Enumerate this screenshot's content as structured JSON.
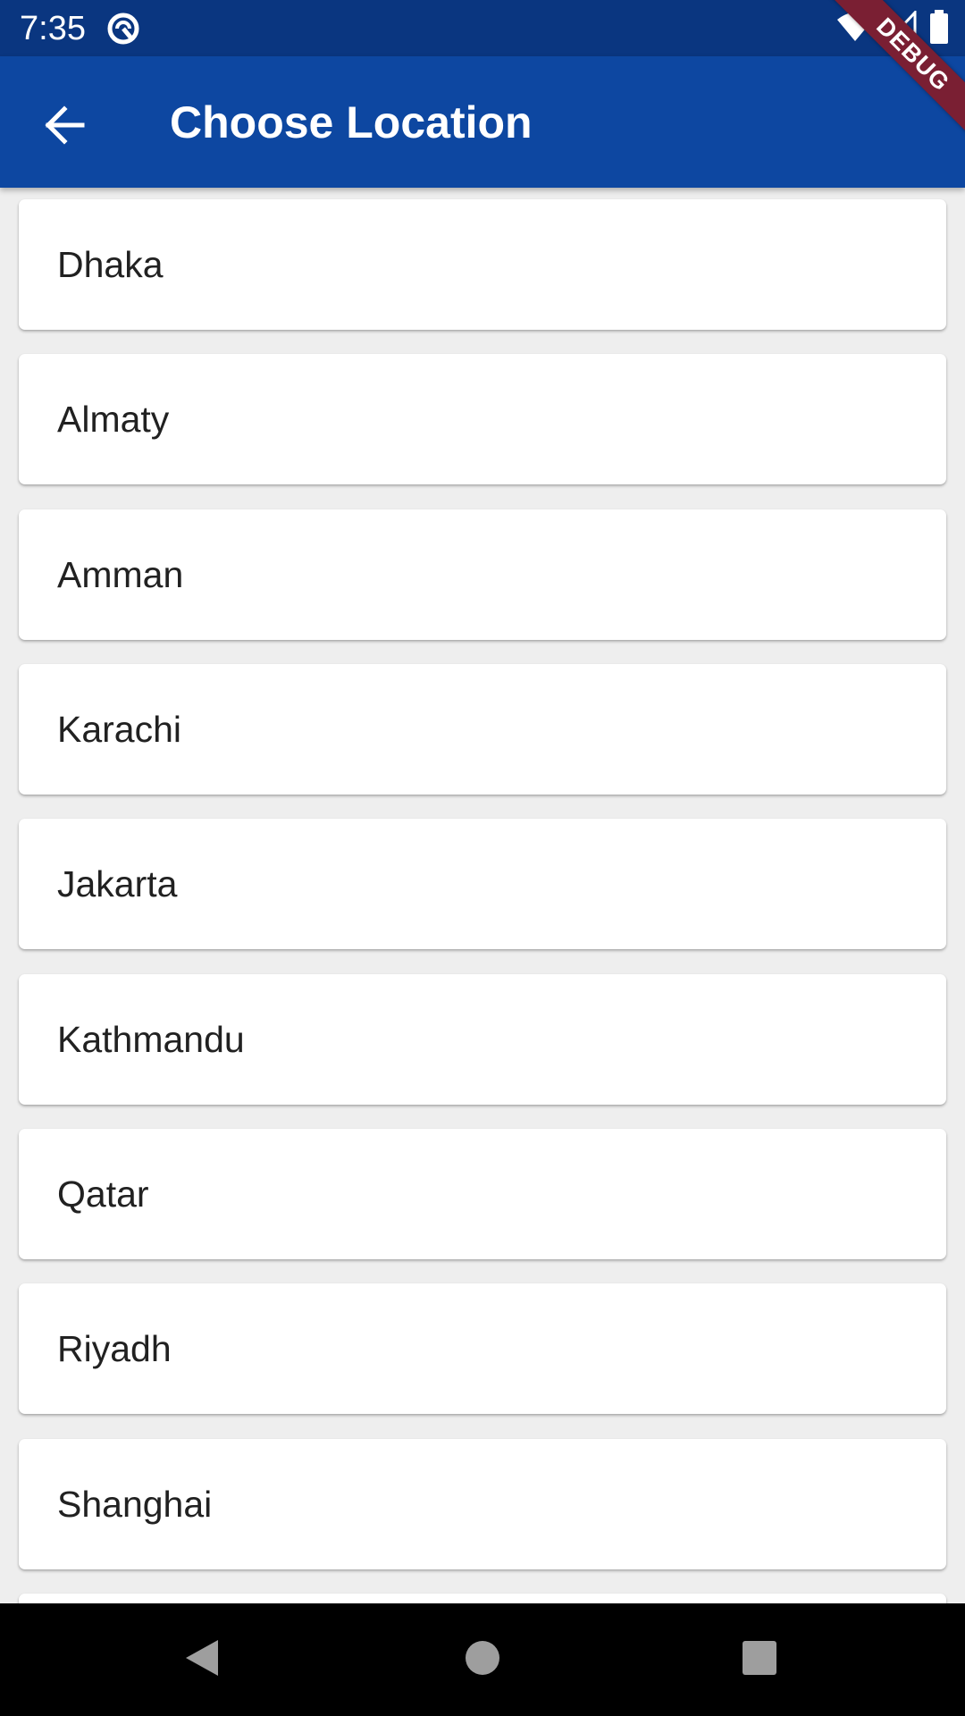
{
  "status_bar": {
    "time": "7:35"
  },
  "app_bar": {
    "title": "Choose Location"
  },
  "debug_banner": {
    "label": "DEBUG"
  },
  "locations": [
    "Dhaka",
    "Almaty",
    "Amman",
    "Karachi",
    "Jakarta",
    "Kathmandu",
    "Qatar",
    "Riyadh",
    "Shanghai",
    ""
  ],
  "colors": {
    "status_bar": "#0a3680",
    "app_bar": "#0d47a1",
    "background": "#eeeeee",
    "card": "#ffffff",
    "debug_ribbon": "#7a1f33"
  }
}
